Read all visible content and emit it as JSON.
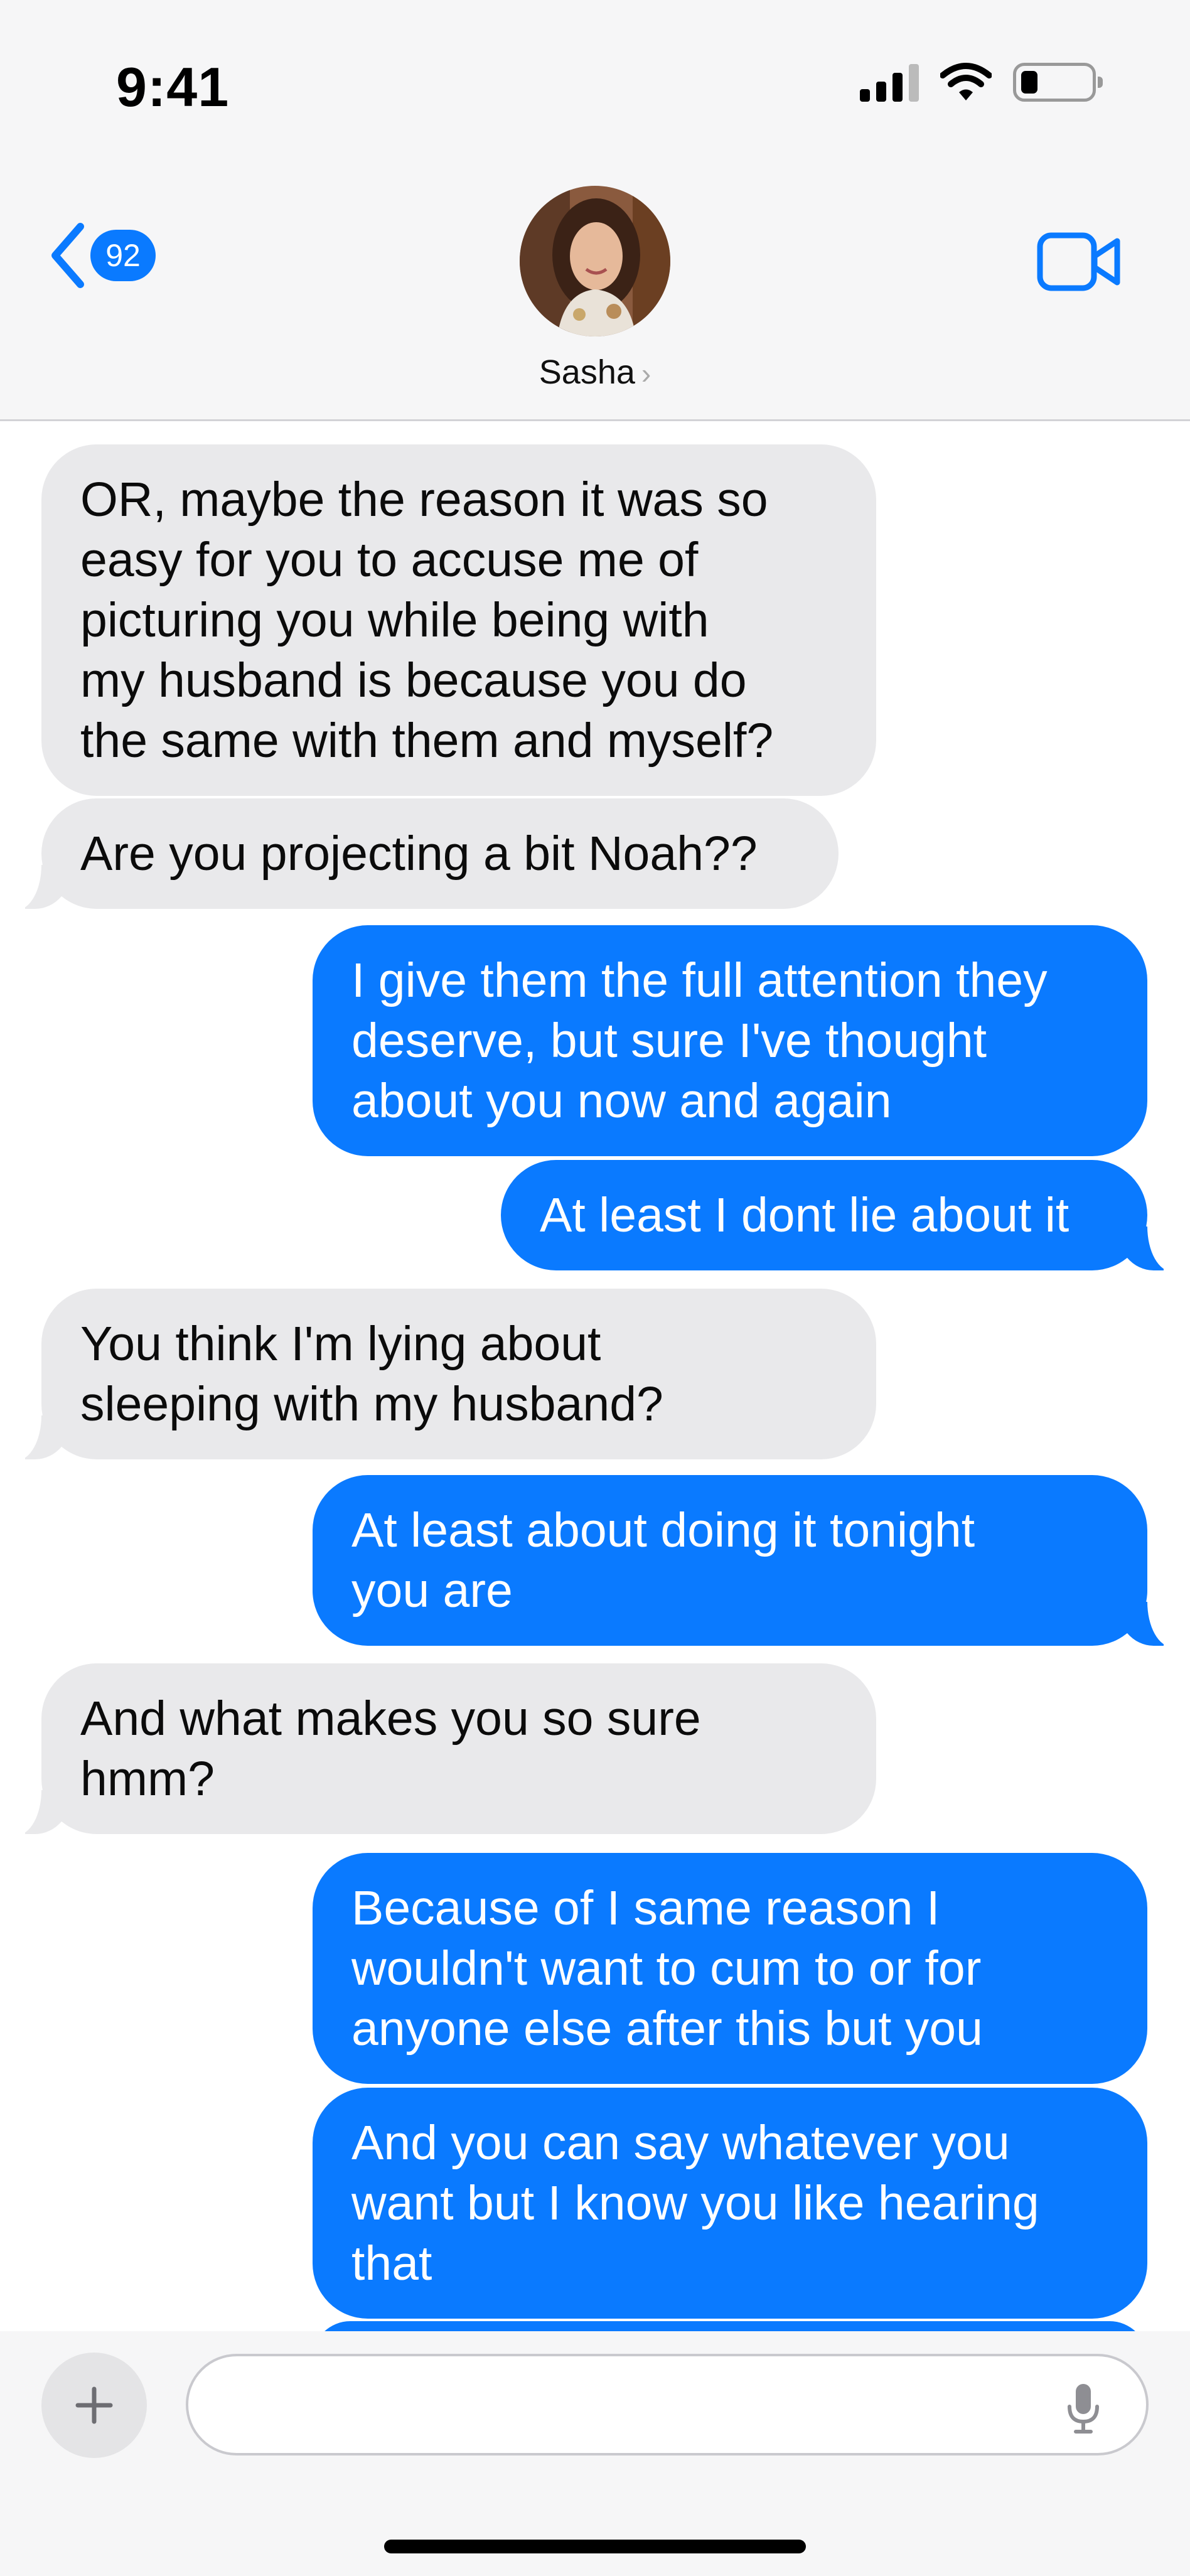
{
  "status": {
    "time": "9:41"
  },
  "header": {
    "back_badge": "92",
    "contact_name": "Sasha",
    "contact_chevron": "›"
  },
  "messages": [
    {
      "side": "in",
      "lines": [
        "OR, maybe the reason it was so",
        "easy for you to accuse me of",
        "picturing you while being with",
        "my husband is because you do",
        "the same with them and myself?"
      ]
    },
    {
      "side": "in",
      "lines": [
        "Are you projecting a bit Noah??"
      ]
    },
    {
      "side": "out",
      "lines": [
        "I give them the full attention they",
        "deserve, but sure I've thought",
        "about you now and again"
      ]
    },
    {
      "side": "out",
      "lines": [
        "At least I dont lie about it"
      ]
    },
    {
      "side": "in",
      "lines": [
        "You think I'm lying about",
        "sleeping with my husband?"
      ]
    },
    {
      "side": "out",
      "lines": [
        "At least about doing it tonight",
        "you are"
      ]
    },
    {
      "side": "in",
      "lines": [
        "And what makes you so sure",
        "hmm?"
      ]
    },
    {
      "side": "out",
      "lines": [
        "Because of I same reason I",
        "wouldn't want to cum to or for",
        "anyone else after this but you"
      ]
    },
    {
      "side": "out",
      "lines": [
        "And you can say whatever you",
        "want but I know you like hearing",
        "that"
      ]
    }
  ],
  "composer": {
    "placeholder": "",
    "plus_label": "+"
  },
  "colors": {
    "outgoing": "#0a7aff",
    "incoming": "#e9e9eb",
    "accent": "#0a7aff"
  },
  "icons": [
    "back-chevron-icon",
    "video-camera-icon",
    "plus-icon",
    "microphone-icon",
    "wifi-icon",
    "signal-icon",
    "battery-icon"
  ]
}
